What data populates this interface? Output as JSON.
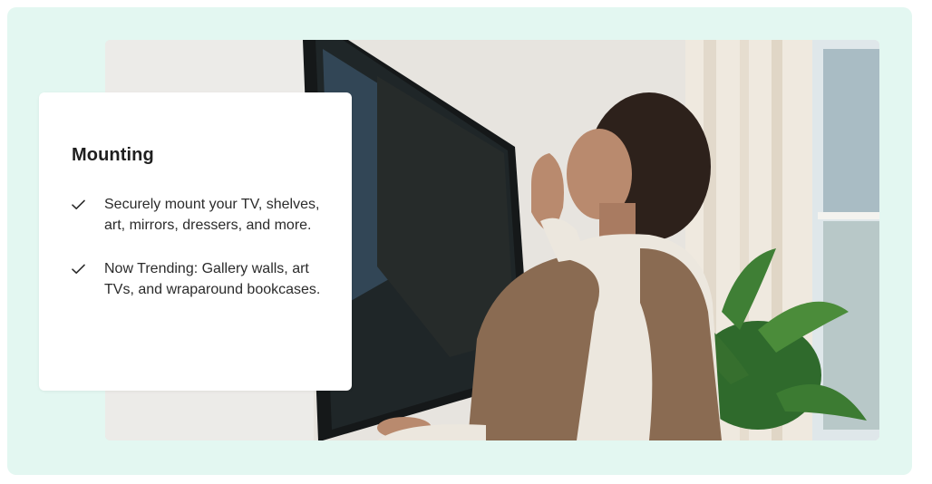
{
  "section": {
    "title": "Mounting",
    "features": [
      {
        "icon": "checkmark-icon",
        "text": "Securely mount your TV, shelves, art, mirrors, dressers, and more."
      },
      {
        "icon": "checkmark-icon",
        "text": "Now Trending: Gallery walls, art TVs, and wraparound bookcases."
      }
    ]
  },
  "colors": {
    "frame_background": "#e3f7f1",
    "card_background": "#ffffff",
    "text": "#2b2b2b"
  }
}
